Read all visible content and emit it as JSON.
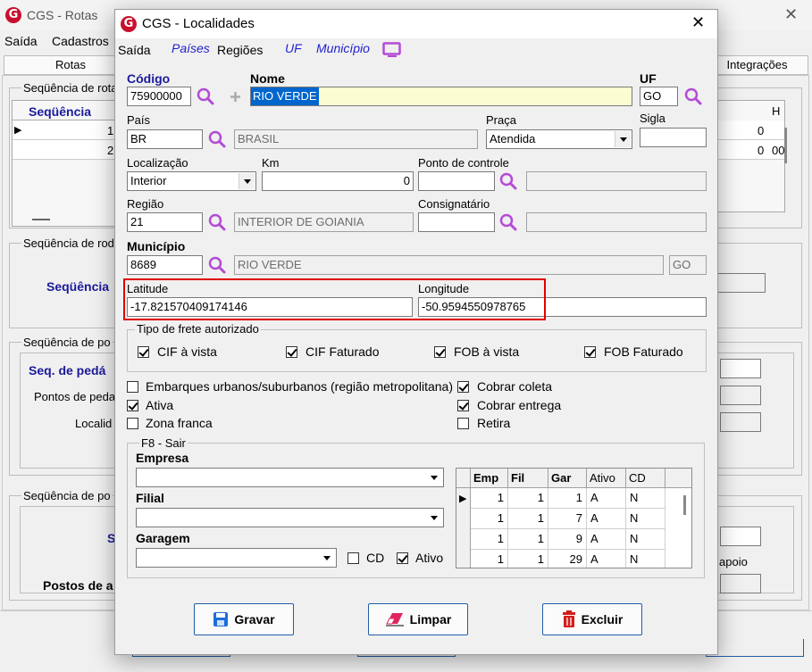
{
  "background_window": {
    "title": "CGS - Rotas",
    "menu": [
      "Saída",
      "Cadastros"
    ],
    "tabs": {
      "left": "Rotas",
      "right": "Integrações"
    },
    "sections": {
      "seq_rotas": "Seqüência de rotas",
      "seq_rod": "Seqüência de rod",
      "seq_pos1": "Seqüência de po",
      "seq_pos2": "Seqüência de po"
    },
    "grid": {
      "header": "Seqüência",
      "header_h": "H",
      "rows": [
        "1",
        "2"
      ],
      "right_rows": [
        [
          "0",
          ""
        ],
        [
          "0",
          "00"
        ]
      ]
    },
    "labels": {
      "sequencia_blue": "Seqüência",
      "seq_pedagio": "Seq. de pedá",
      "pontos_pedagio": "Pontos de peda",
      "localid": "Localid",
      "s_letter": "S",
      "postos": "Postos de a",
      "apoio": "apoio"
    }
  },
  "dialog": {
    "title": "CGS - Localidades",
    "close_symbol": "✕",
    "menu": {
      "saida": "Saída",
      "paises": "Países",
      "regioes": "Regiões",
      "uf": "UF",
      "municipio": "Município"
    },
    "fields": {
      "codigo": {
        "label": "Código",
        "value": "75900000"
      },
      "nome": {
        "label": "Nome",
        "value": "RIO VERDE"
      },
      "uf": {
        "label": "UF",
        "value": "GO"
      },
      "pais": {
        "label": "País",
        "code": "BR",
        "name": "BRASIL"
      },
      "praca": {
        "label": "Praça",
        "value": "Atendida"
      },
      "sigla": {
        "label": "Sigla",
        "value": ""
      },
      "localizacao": {
        "label": "Localização",
        "value": "Interior"
      },
      "km": {
        "label": "Km",
        "value": "0"
      },
      "ponto_controle": {
        "label": "Ponto de controle",
        "code": "",
        "name": ""
      },
      "regiao": {
        "label": "Região",
        "code": "21",
        "name": "INTERIOR DE GOIANIA"
      },
      "consignatario": {
        "label": "Consignatário",
        "code": "",
        "name": ""
      },
      "municipio": {
        "label": "Município",
        "code": "8689",
        "name": "RIO VERDE",
        "uf": "GO"
      },
      "latitude": {
        "label": "Latitude",
        "value": "-17.821570409174146"
      },
      "longitude": {
        "label": "Longitude",
        "value": "-50.9594550978765"
      }
    },
    "frete": {
      "legend": "Tipo de frete autorizado",
      "options": [
        {
          "label": "CIF à vista",
          "checked": true
        },
        {
          "label": "CIF Faturado",
          "checked": true
        },
        {
          "label": "FOB à vista",
          "checked": true
        },
        {
          "label": "FOB Faturado",
          "checked": true
        }
      ]
    },
    "checks_left": [
      {
        "label": "Embarques urbanos/suburbanos (região metropolitana)",
        "checked": false
      },
      {
        "label": "Ativa",
        "checked": true
      },
      {
        "label": "Zona franca",
        "checked": false
      }
    ],
    "checks_right": [
      {
        "label": "Cobrar coleta",
        "checked": true
      },
      {
        "label": "Cobrar entrega",
        "checked": true
      },
      {
        "label": "Retira",
        "checked": false
      }
    ],
    "f8": {
      "legend": "F8 - Sair",
      "empresa": "Empresa",
      "filial": "Filial",
      "garagem": "Garagem",
      "cd": {
        "label": "CD",
        "checked": false
      },
      "ativo": {
        "label": "Ativo",
        "checked": true
      },
      "grid": {
        "columns": [
          "Emp",
          "Fil",
          "Gar",
          "Ativo",
          "CD"
        ],
        "rows": [
          [
            "1",
            "1",
            "1",
            "A",
            "N"
          ],
          [
            "1",
            "1",
            "7",
            "A",
            "N"
          ],
          [
            "1",
            "1",
            "9",
            "A",
            "N"
          ],
          [
            "1",
            "1",
            "29",
            "A",
            "N"
          ]
        ]
      }
    },
    "buttons": {
      "gravar": "Gravar",
      "limpar": "Limpar",
      "excluir": "Excluir"
    },
    "colors": {
      "highlight_red": "#e00000",
      "nome_bg": "#fcfcd2",
      "link_blue": "#1f1fd0",
      "icon_purple": "#b44bd6"
    }
  }
}
